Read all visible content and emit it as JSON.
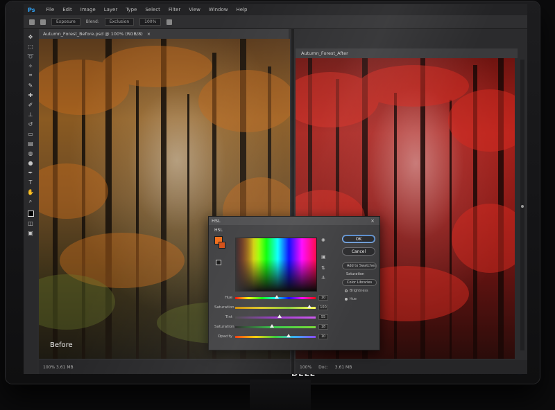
{
  "menubar": {
    "logo": "Ps",
    "items": [
      "File",
      "Edit",
      "Image",
      "Layer",
      "Type",
      "Select",
      "Filter",
      "View",
      "Window",
      "Help"
    ]
  },
  "optionsbar": {
    "preset": "Exposure",
    "label": "Blend:",
    "mode": "Exclusion",
    "zoom": "100%"
  },
  "documents": {
    "left_tab": "Autumn_Forest_Before.psd @ 100% (RGB/8)",
    "right_tab": "Autumn_Forest_After",
    "before_label": "Before",
    "status_left": "100% 3.61 MB",
    "status_right": [
      "100%",
      "Doc:",
      "3.61 MB"
    ]
  },
  "color_picker": {
    "title": "HSL",
    "subtitle": "HSL",
    "buttons": {
      "ok": "OK",
      "cancel": "Cancel",
      "add_swatches": "Add to Swatches",
      "libraries": "Color Libraries"
    },
    "options": [
      "Saturation",
      "Brightness",
      "Hue"
    ],
    "sliders": [
      {
        "label": "Hue",
        "value": "10",
        "pos": 0.52,
        "gradient": "linear-gradient(90deg,#ff0000,#ffff00,#00ff00,#00ffff,#0000ff,#ff00ff,#ff0000)"
      },
      {
        "label": "Saturation",
        "value": "100",
        "pos": 0.92,
        "gradient": "linear-gradient(90deg,#cc8800,#ddcc22,#88cc33,#ffff55)"
      },
      {
        "label": "Tint",
        "value": "55",
        "pos": 0.55,
        "gradient": "linear-gradient(90deg,#444,#9a33cc,#cc55ee)"
      },
      {
        "label": "Saturation",
        "value": "18",
        "pos": 0.46,
        "gradient": "linear-gradient(90deg,#222,#33cc44,#77dd33)"
      },
      {
        "label": "Opacity",
        "value": "10",
        "pos": 0.66,
        "gradient": "linear-gradient(90deg,#ff3300,#ffcc00,#33cc33,#33aaff,#8844ff)"
      }
    ],
    "new_color": "#f06a14",
    "current_color": "#d24a10"
  },
  "monitor": {
    "brand": "DELL"
  }
}
